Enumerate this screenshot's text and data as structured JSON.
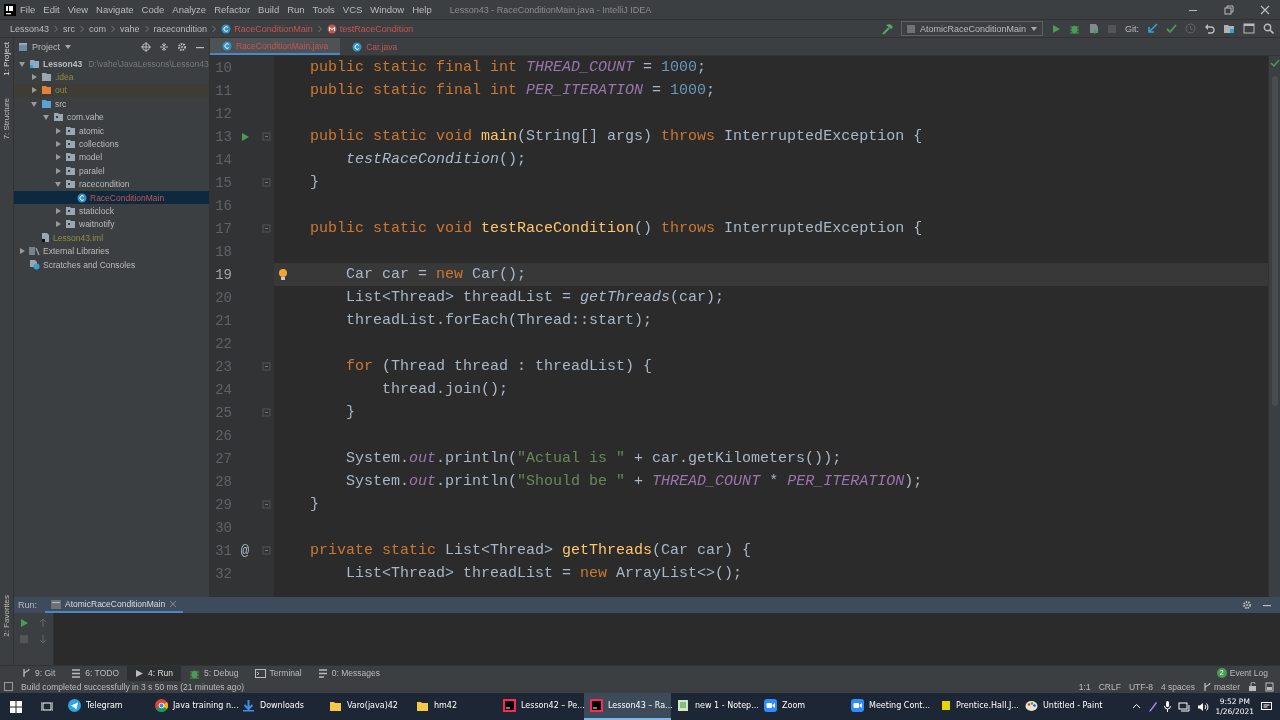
{
  "window": {
    "title": "Lesson43 - RaceConditionMain.java - IntelliJ IDEA"
  },
  "menu": [
    "File",
    "Edit",
    "View",
    "Navigate",
    "Code",
    "Analyze",
    "Refactor",
    "Build",
    "Run",
    "Tools",
    "VCS",
    "Window",
    "Help"
  ],
  "breadcrumbs": [
    {
      "label": "Lesson43",
      "kind": "plain"
    },
    {
      "label": "src",
      "kind": "plain"
    },
    {
      "label": "com",
      "kind": "plain"
    },
    {
      "label": "vahe",
      "kind": "plain"
    },
    {
      "label": "racecondition",
      "kind": "plain"
    },
    {
      "label": "RaceConditionMain",
      "kind": "class"
    },
    {
      "label": "testRaceCondition",
      "kind": "method"
    }
  ],
  "run_config": "AtomicRaceConditionMain",
  "vcs_label": "Git:",
  "side_tabs": [
    "1: Project",
    "7: Structure",
    "2: Favorites"
  ],
  "project_panel": {
    "title": "Project"
  },
  "tree": [
    {
      "label": "Lesson43",
      "kind": "module",
      "note": "D:\\vahe\\JavaLessons\\Lesson43",
      "expanded": true,
      "selected": false,
      "ignored": false,
      "error": false,
      "children": [
        {
          "label": ".idea",
          "kind": "folder",
          "expanded": false,
          "selected": false,
          "ignored": true,
          "error": false
        },
        {
          "label": "out",
          "kind": "excluded",
          "expanded": false,
          "selected": false,
          "ignored": true,
          "error": false
        },
        {
          "label": "src",
          "kind": "source",
          "expanded": true,
          "selected": false,
          "ignored": false,
          "error": false,
          "children": [
            {
              "label": "com.vahe",
              "kind": "package",
              "expanded": true,
              "selected": false,
              "ignored": false,
              "error": false,
              "children": [
                {
                  "label": "atomic",
                  "kind": "package",
                  "expanded": false,
                  "selected": false,
                  "ignored": false,
                  "error": false
                },
                {
                  "label": "collections",
                  "kind": "package",
                  "expanded": false,
                  "selected": false,
                  "ignored": false,
                  "error": false
                },
                {
                  "label": "model",
                  "kind": "package",
                  "expanded": false,
                  "selected": false,
                  "ignored": false,
                  "error": false
                },
                {
                  "label": "paralel",
                  "kind": "package",
                  "expanded": false,
                  "selected": false,
                  "ignored": false,
                  "error": false
                },
                {
                  "label": "racecondition",
                  "kind": "package",
                  "expanded": true,
                  "selected": false,
                  "ignored": false,
                  "error": false,
                  "children": [
                    {
                      "label": "RaceConditionMain",
                      "kind": "class",
                      "selected": true,
                      "ignored": false,
                      "error": true
                    }
                  ]
                },
                {
                  "label": "staticlock",
                  "kind": "package",
                  "expanded": false,
                  "selected": false,
                  "ignored": false,
                  "error": false
                },
                {
                  "label": "waitnotify",
                  "kind": "package",
                  "expanded": false,
                  "selected": false,
                  "ignored": false,
                  "error": false
                }
              ]
            }
          ]
        },
        {
          "label": "Lesson43.iml",
          "kind": "file",
          "selected": false,
          "ignored": true,
          "error": false
        }
      ]
    },
    {
      "label": "External Libraries",
      "kind": "library",
      "expanded": false,
      "selected": false,
      "ignored": false,
      "error": false
    },
    {
      "label": "Scratches and Consoles",
      "kind": "scratch",
      "selected": false,
      "ignored": false,
      "error": false
    }
  ],
  "editor_tabs": [
    {
      "label": "RaceConditionMain.java",
      "selected": true
    },
    {
      "label": "Car.java",
      "selected": false
    }
  ],
  "code": [
    {
      "n": "10",
      "current": false,
      "fold": false,
      "tokens": [
        {
          "kind": "kw",
          "text": "    public static final int "
        },
        {
          "kind": "field",
          "text": "THREAD_COUNT"
        },
        {
          "kind": "plain",
          "text": " = "
        },
        {
          "kind": "num",
          "text": "1000"
        },
        {
          "kind": "plain",
          "text": ";"
        }
      ]
    },
    {
      "n": "11",
      "current": false,
      "fold": false,
      "tokens": [
        {
          "kind": "kw",
          "text": "    public static final int "
        },
        {
          "kind": "field",
          "text": "PER_ITERATION"
        },
        {
          "kind": "plain",
          "text": " = "
        },
        {
          "kind": "num",
          "text": "1000"
        },
        {
          "kind": "plain",
          "text": ";"
        }
      ]
    },
    {
      "n": "12",
      "current": false,
      "fold": false
    },
    {
      "n": "13",
      "current": false,
      "fold": true,
      "marker": {
        "kind": "run"
      },
      "tokens": [
        {
          "kind": "kw",
          "text": "    public static void "
        },
        {
          "kind": "decl",
          "text": "main"
        },
        {
          "kind": "plain",
          "text": "(String[] args) "
        },
        {
          "kind": "kw",
          "text": "throws "
        },
        {
          "kind": "plain",
          "text": "InterruptedException {"
        }
      ]
    },
    {
      "n": "14",
      "current": false,
      "fold": false,
      "tokens": [
        {
          "kind": "call",
          "text": "        testRaceCondition"
        },
        {
          "kind": "plain",
          "text": "();"
        }
      ]
    },
    {
      "n": "15",
      "current": false,
      "fold": true,
      "tokens": [
        {
          "kind": "plain",
          "text": "    }"
        }
      ]
    },
    {
      "n": "16",
      "current": false,
      "fold": false
    },
    {
      "n": "17",
      "current": false,
      "fold": true,
      "tokens": [
        {
          "kind": "kw",
          "text": "    public static void "
        },
        {
          "kind": "decl",
          "text": "testRaceCondition"
        },
        {
          "kind": "plain",
          "text": "() "
        },
        {
          "kind": "kw",
          "text": "throws "
        },
        {
          "kind": "plain",
          "text": "InterruptedException {"
        }
      ]
    },
    {
      "n": "18",
      "current": false,
      "fold": false
    },
    {
      "n": "19",
      "current": true,
      "fold": false,
      "marker": {
        "kind": "bulb"
      },
      "tokens": [
        {
          "kind": "plain",
          "text": "        Car car = "
        },
        {
          "kind": "kw",
          "text": "new "
        },
        {
          "kind": "plain",
          "text": "Car();"
        }
      ]
    },
    {
      "n": "20",
      "current": false,
      "fold": false,
      "tokens": [
        {
          "kind": "plain",
          "text": "        List<Thread> threadList = "
        },
        {
          "kind": "call",
          "text": "getThreads"
        },
        {
          "kind": "plain",
          "text": "(car);"
        }
      ]
    },
    {
      "n": "21",
      "current": false,
      "fold": false,
      "tokens": [
        {
          "kind": "plain",
          "text": "        threadList.forEach(Thread::start);"
        }
      ]
    },
    {
      "n": "22",
      "current": false,
      "fold": false
    },
    {
      "n": "23",
      "current": false,
      "fold": true,
      "tokens": [
        {
          "kind": "kw",
          "text": "        for "
        },
        {
          "kind": "plain",
          "text": "(Thread thread : threadList) {"
        }
      ]
    },
    {
      "n": "24",
      "current": false,
      "fold": false,
      "tokens": [
        {
          "kind": "plain",
          "text": "            thread.join();"
        }
      ]
    },
    {
      "n": "25",
      "current": false,
      "fold": true,
      "tokens": [
        {
          "kind": "plain",
          "text": "        }"
        }
      ]
    },
    {
      "n": "26",
      "current": false,
      "fold": false
    },
    {
      "n": "27",
      "current": false,
      "fold": false,
      "tokens": [
        {
          "kind": "plain",
          "text": "        System."
        },
        {
          "kind": "field",
          "text": "out"
        },
        {
          "kind": "plain",
          "text": ".println("
        },
        {
          "kind": "str",
          "text": "\"Actual is \""
        },
        {
          "kind": "plain",
          "text": " + car.getKilometers());"
        }
      ]
    },
    {
      "n": "28",
      "current": false,
      "fold": false,
      "tokens": [
        {
          "kind": "plain",
          "text": "        System."
        },
        {
          "kind": "field",
          "text": "out"
        },
        {
          "kind": "plain",
          "text": ".println("
        },
        {
          "kind": "str",
          "text": "\"Should be \""
        },
        {
          "kind": "plain",
          "text": " + "
        },
        {
          "kind": "field",
          "text": "THREAD_COUNT"
        },
        {
          "kind": "plain",
          "text": " * "
        },
        {
          "kind": "field",
          "text": "PER_ITERATION"
        },
        {
          "kind": "plain",
          "text": ");"
        }
      ]
    },
    {
      "n": "29",
      "current": false,
      "fold": true,
      "tokens": [
        {
          "kind": "plain",
          "text": "    }"
        }
      ]
    },
    {
      "n": "30",
      "current": false,
      "fold": false
    },
    {
      "n": "31",
      "current": false,
      "fold": true,
      "gutter_text": "@",
      "tokens": [
        {
          "kind": "kw",
          "text": "    private static "
        },
        {
          "kind": "plain",
          "text": "List<Thread> "
        },
        {
          "kind": "decl",
          "text": "getThreads"
        },
        {
          "kind": "plain",
          "text": "(Car car) {"
        }
      ]
    },
    {
      "n": "32",
      "current": false,
      "fold": false,
      "tokens": [
        {
          "kind": "plain",
          "text": "        List<Thread> threadList = "
        },
        {
          "kind": "kw",
          "text": "new "
        },
        {
          "kind": "plain",
          "text": "ArrayList<>();"
        }
      ]
    }
  ],
  "run_panel": {
    "label": "Run:",
    "tab": "AtomicRaceConditionMain"
  },
  "tool_buttons": [
    {
      "label": "9: Git",
      "kind": "branch",
      "selected": false
    },
    {
      "label": "6: TODO",
      "kind": "list",
      "selected": false
    },
    {
      "label": "4: Run",
      "kind": "run",
      "selected": true
    },
    {
      "label": "5: Debug",
      "kind": "bug",
      "selected": false
    },
    {
      "label": "Terminal",
      "kind": "terminal",
      "selected": false
    },
    {
      "label": "0: Messages",
      "kind": "messages",
      "selected": false
    }
  ],
  "event_log": {
    "label": "Event Log",
    "count": "2"
  },
  "status_bar": {
    "message": "Build completed successfully in 3 s 50 ms (21 minutes ago)",
    "items": [
      "1:1",
      "CRLF",
      "UTF-8",
      "4 spaces"
    ],
    "branch": "master"
  },
  "taskbar": {
    "items": [
      {
        "label": "Telegram",
        "kind": "telegram",
        "selected": false
      },
      {
        "label": "Java training n...",
        "kind": "chrome",
        "selected": false
      },
      {
        "label": "Downloads",
        "kind": "download",
        "selected": false
      },
      {
        "label": "Varo(java)42",
        "kind": "folder",
        "selected": false
      },
      {
        "label": "hm42",
        "kind": "folder",
        "selected": false
      },
      {
        "label": "Lesson42 – Pe...",
        "kind": "idea",
        "selected": false
      },
      {
        "label": "Lesson43 – Ra...",
        "kind": "idea",
        "selected": true
      },
      {
        "label": "new 1 - Notep...",
        "kind": "notepad",
        "selected": false
      },
      {
        "label": "Zoom",
        "kind": "zoom",
        "selected": false
      },
      {
        "label": "Meeting Cont...",
        "kind": "zoom",
        "selected": false
      },
      {
        "label": "Prentice.Hall.J...",
        "kind": "book",
        "selected": false
      },
      {
        "label": "Untitled - Paint",
        "kind": "paint",
        "selected": false
      }
    ],
    "time": "9:52 PM",
    "date": "1/26/2021"
  }
}
